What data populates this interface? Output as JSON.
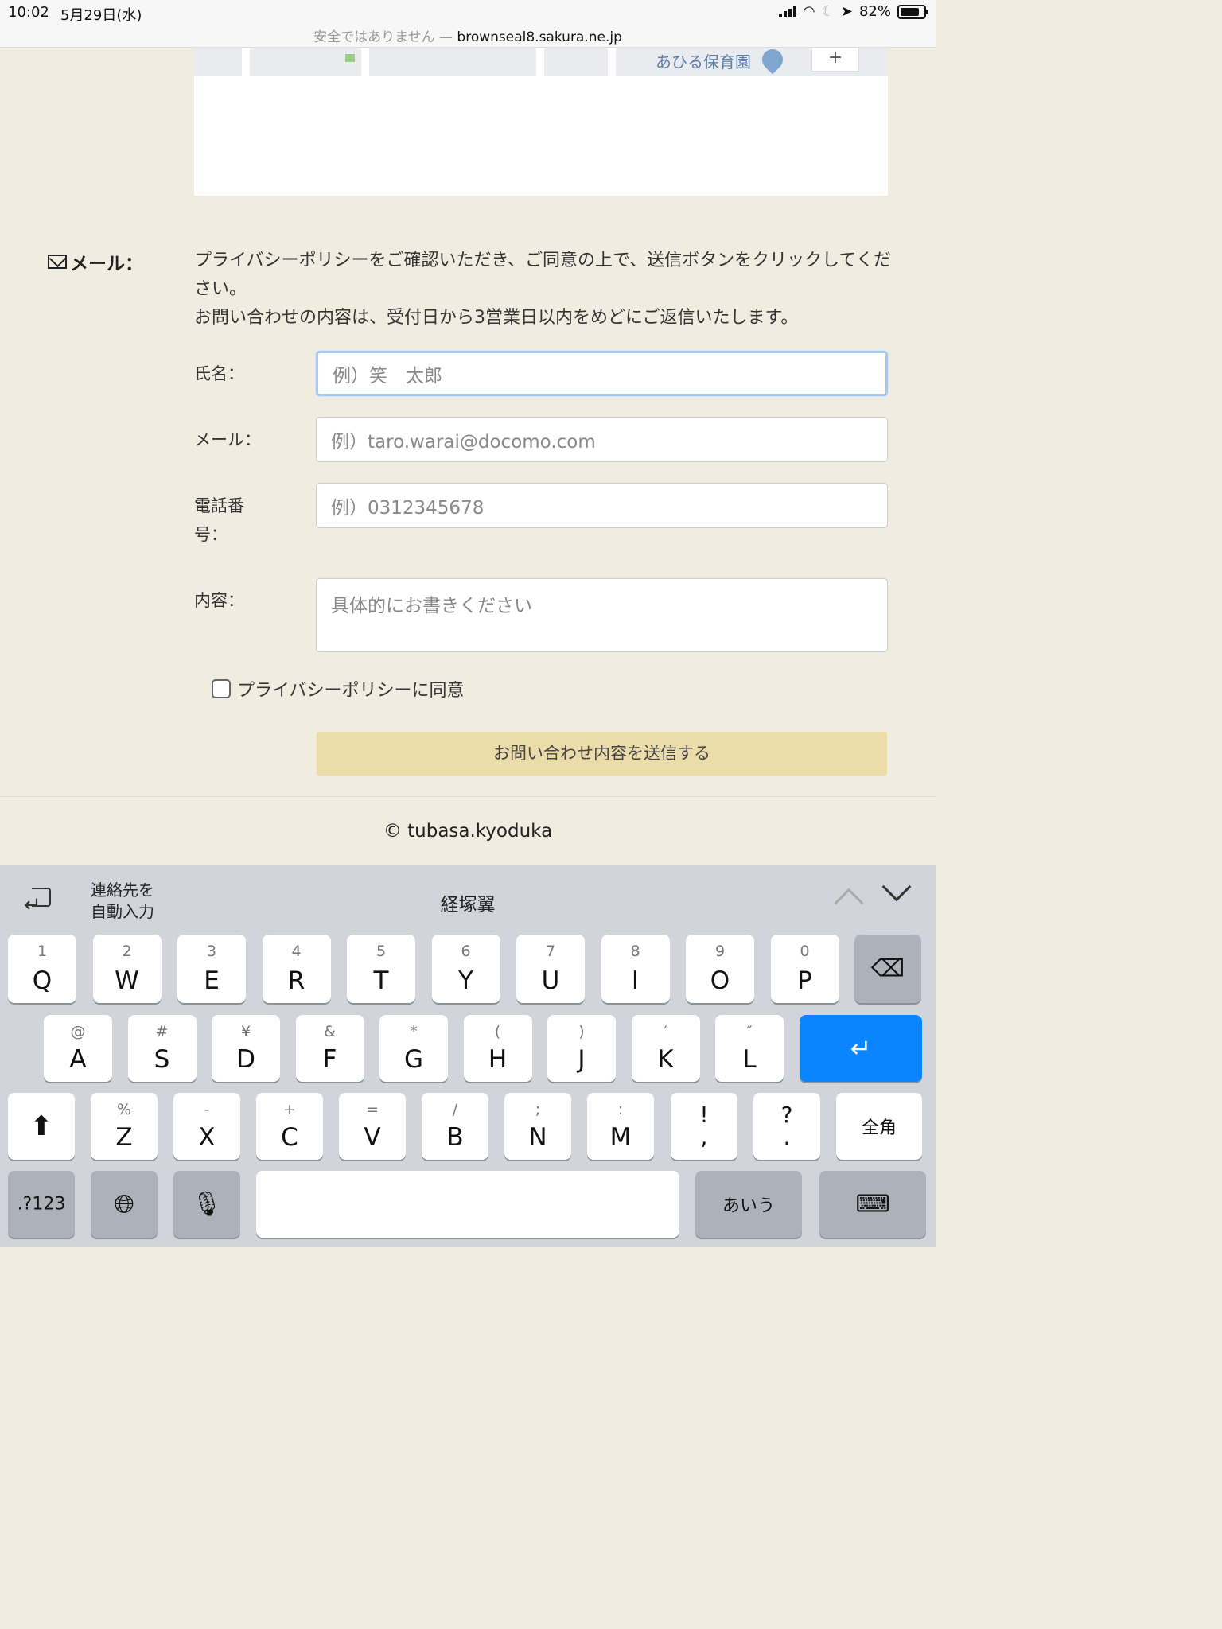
{
  "status_bar": {
    "time": "10:02",
    "date": "5月29日(水)",
    "url_prefix": "安全ではありません — ",
    "url_host": "brownseal8.sakura.ne.jp",
    "battery": "82%",
    "battery_level": 0.82
  },
  "map": {
    "place_label": "あひる保育園",
    "zoom_in": "+"
  },
  "contact": {
    "section_label": "メール：",
    "intro_line1": "プライバシーポリシーをご確認いただき、ご同意の上で、送信ボタンをクリックしてください。",
    "intro_line2": "お問い合わせの内容は、受付日から3営業日以内をめどにご返信いたします。",
    "name_label": "氏名：",
    "name_placeholder": "例）笑　太郎",
    "email_label": "メール：",
    "email_placeholder": "例）taro.warai@docomo.com",
    "phone_label": "電話番号：",
    "phone_placeholder": "例）0312345678",
    "content_label": "内容：",
    "content_placeholder": "具体的にお書きください",
    "agree_label": "プライバシーポリシーに同意",
    "submit_label": "お問い合わせ内容を送信する"
  },
  "footer": {
    "copyright": "© tubasa.kyoduka"
  },
  "keyboard": {
    "autofill_label_1": "連絡先を",
    "autofill_label_2": "自動入力",
    "suggestion": "経塚翼",
    "row1": [
      {
        "sub": "1",
        "main": "Q"
      },
      {
        "sub": "2",
        "main": "W"
      },
      {
        "sub": "3",
        "main": "E"
      },
      {
        "sub": "4",
        "main": "R"
      },
      {
        "sub": "5",
        "main": "T"
      },
      {
        "sub": "6",
        "main": "Y"
      },
      {
        "sub": "7",
        "main": "U"
      },
      {
        "sub": "8",
        "main": "I"
      },
      {
        "sub": "9",
        "main": "O"
      },
      {
        "sub": "0",
        "main": "P"
      }
    ],
    "row2": [
      {
        "sub": "@",
        "main": "A"
      },
      {
        "sub": "#",
        "main": "S"
      },
      {
        "sub": "¥",
        "main": "D"
      },
      {
        "sub": "&",
        "main": "F"
      },
      {
        "sub": "*",
        "main": "G"
      },
      {
        "sub": "(",
        "main": "H"
      },
      {
        "sub": ")",
        "main": "J"
      },
      {
        "sub": "′",
        "main": "K"
      },
      {
        "sub": "″",
        "main": "L"
      }
    ],
    "row3": [
      {
        "sub": "%",
        "main": "Z"
      },
      {
        "sub": "-",
        "main": "X"
      },
      {
        "sub": "+",
        "main": "C"
      },
      {
        "sub": "=",
        "main": "V"
      },
      {
        "sub": "/",
        "main": "B"
      },
      {
        "sub": ";",
        "main": "N"
      },
      {
        "sub": ":",
        "main": "M"
      }
    ],
    "punct1_top": "!",
    "punct1_bottom": ",",
    "punct2_top": "?",
    "punct2_bottom": ".",
    "zenkaku": "全角",
    "numbers": ".?123",
    "kana": "あいう",
    "return_color": "#0a84ff"
  }
}
